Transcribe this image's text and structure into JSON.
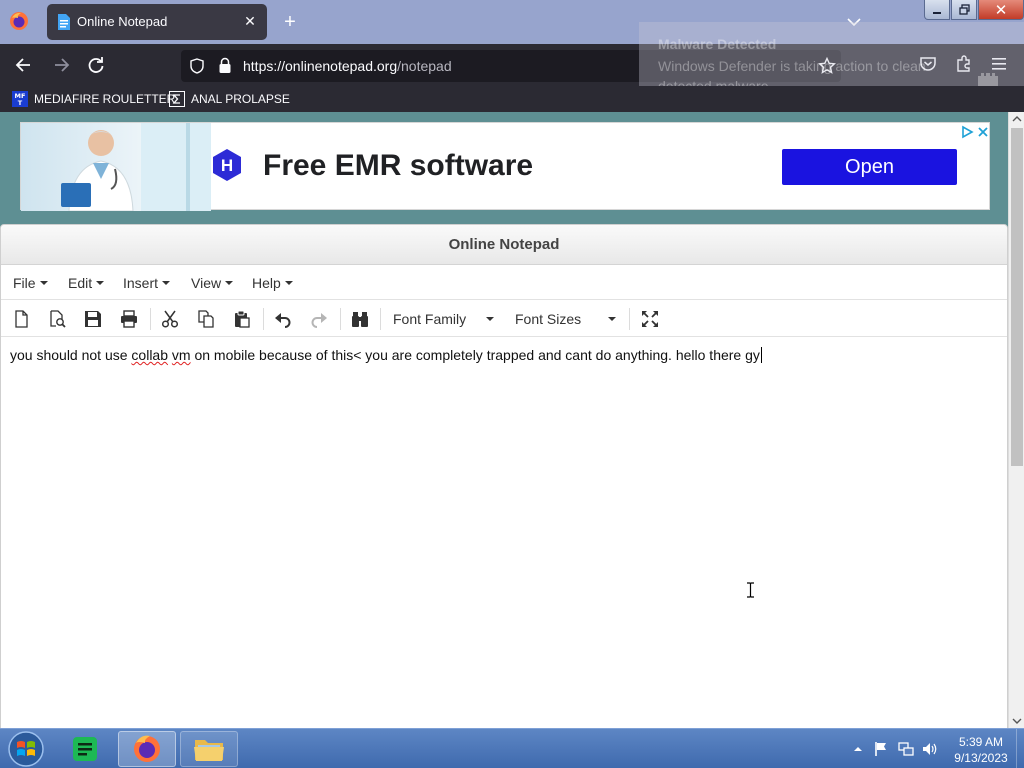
{
  "browser": {
    "tab_title": "Online Notepad",
    "url_domain": "https://onlinenotepad.org",
    "url_path": "/notepad",
    "bookmarks": [
      {
        "icon": "mediafire-icon",
        "label": "MEDIAFIRE ROULETTER",
        "badge": "MF\nT"
      },
      {
        "icon": "sigma-icon",
        "label": "ANAL PROLAPSE"
      }
    ]
  },
  "toast": {
    "title": "Malware Detected",
    "body": "Windows Defender is taking action to clean detected malware."
  },
  "ad": {
    "logo_letter": "H",
    "headline": "Free EMR software",
    "button": "Open"
  },
  "notepad": {
    "title": "Online Notepad",
    "menus": [
      "File",
      "Edit",
      "Insert",
      "View",
      "Help"
    ],
    "font_family_label": "Font Family",
    "font_sizes_label": "Font Sizes",
    "text_before": "you should not use ",
    "text_misspelled_1": "collab",
    "text_space": " ",
    "text_misspelled_2": "vm",
    "text_after": " on mobile because of this< you are completely trapped and cant do anything. hello there gy"
  },
  "taskbar": {
    "time": "5:39 AM",
    "date": "9/13/2023"
  },
  "colors": {
    "tabbar": "#97a4cd",
    "browser_dark": "#2b2a33",
    "page_bg": "#5e8f93",
    "ad_button": "#1a13e0",
    "taskbar": "#4a76b8"
  }
}
